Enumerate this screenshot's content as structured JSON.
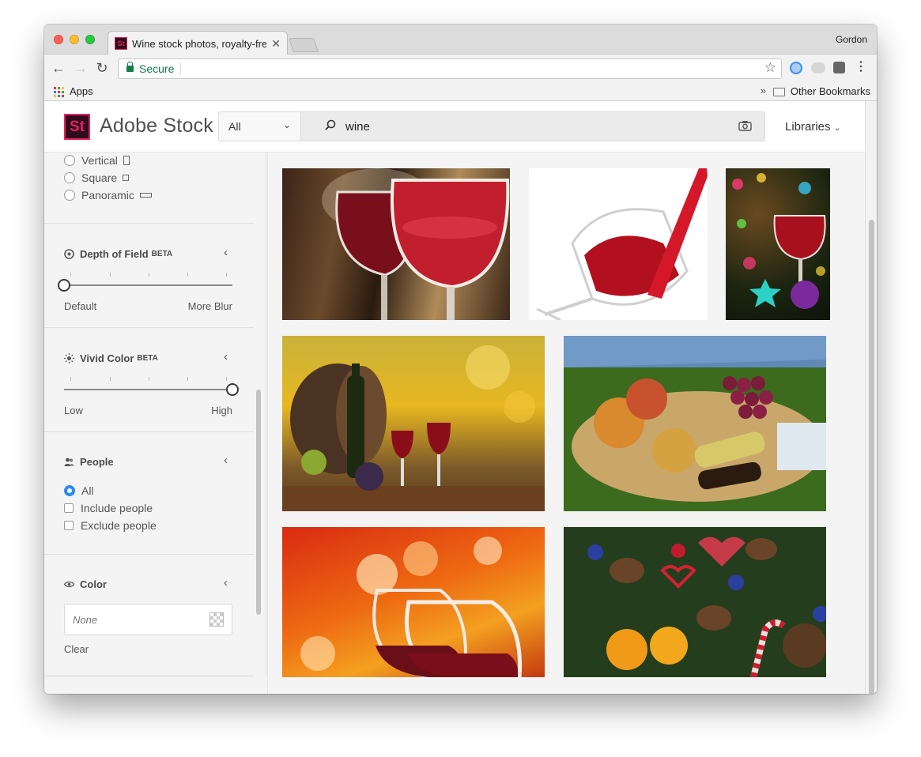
{
  "browser": {
    "tab_title": "Wine stock photos, royalty-free",
    "tab_favicon": "St",
    "close_glyph": "✕",
    "profile_name": "Gordon",
    "secure_label": "Secure",
    "url": "",
    "back_icon": "←",
    "forward_icon": "→",
    "reload_icon": "↻",
    "star_icon": "☆",
    "menu_icon": "⋮",
    "bookmarks": {
      "apps_label": "Apps",
      "overflow_glyph": "»",
      "other_label": "Other Bookmarks"
    }
  },
  "header": {
    "logo_text": "St",
    "brand_name": "Adobe Stock",
    "scope_value": "All",
    "scope_chevron": "⌄",
    "search_value": "wine",
    "libraries_label": "Libraries",
    "libraries_chevron": "⌄"
  },
  "sidebar": {
    "orientation_options": [
      {
        "label": "Vertical",
        "checked": false
      },
      {
        "label": "Square",
        "checked": false
      },
      {
        "label": "Panoramic",
        "checked": false
      }
    ],
    "depth_of_field": {
      "title": "Depth of Field",
      "badge": "BETA",
      "min_label": "Default",
      "max_label": "More Blur",
      "value": 0.0
    },
    "vivid_color": {
      "title": "Vivid Color",
      "badge": "BETA",
      "min_label": "Low",
      "max_label": "High",
      "value": 1.0
    },
    "people": {
      "title": "People",
      "options": [
        {
          "label": "All",
          "selected": true
        },
        {
          "label": "Include people",
          "selected": false
        },
        {
          "label": "Exclude people",
          "selected": false
        }
      ]
    },
    "color": {
      "title": "Color",
      "value_placeholder": "None",
      "clear_label": "Clear"
    },
    "collapse_chevron": "‹"
  },
  "gallery": {
    "images": [
      {
        "subject": "two glasses of red wine close-up"
      },
      {
        "subject": "red wine splashing into glass on white"
      },
      {
        "subject": "wine glass with christmas ornaments and bokeh lights"
      },
      {
        "subject": "wine barrel, bottle, glasses and grapes in autumn"
      },
      {
        "subject": "picnic basket with grapes, bread and wine on grass"
      },
      {
        "subject": "wine glasses toasting with orange bokeh"
      },
      {
        "subject": "christmas decorations, pine cones and tangerines"
      }
    ]
  },
  "colors": {
    "accent_blue": "#2c8af0",
    "brand_pink": "#e8205b",
    "secure_green": "#0b8043"
  }
}
